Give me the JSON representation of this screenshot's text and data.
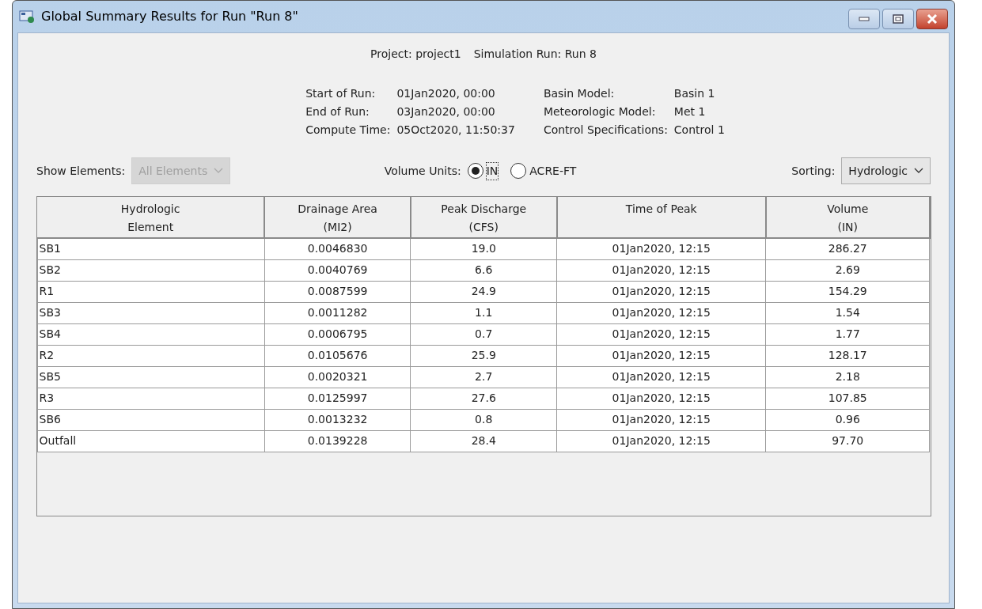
{
  "window": {
    "title": "Global Summary Results for Run \"Run 8\""
  },
  "header": {
    "project": "Project: project1",
    "simulation_run": "Simulation Run: Run 8"
  },
  "info_left": [
    {
      "label": "Start of Run:",
      "value": "01Jan2020, 00:00"
    },
    {
      "label": "End of Run:",
      "value": "03Jan2020, 00:00"
    },
    {
      "label": "Compute Time:",
      "value": "05Oct2020, 11:50:37"
    }
  ],
  "info_right": [
    {
      "label": "Basin Model:",
      "value": "Basin 1"
    },
    {
      "label": "Meteorologic Model:",
      "value": "Met 1"
    },
    {
      "label": "Control Specifications:",
      "value": "Control 1"
    }
  ],
  "show_elements": {
    "label": "Show Elements:",
    "value": "All Elements",
    "disabled": true
  },
  "volume_units": {
    "label": "Volume Units:",
    "options": [
      {
        "label": "IN",
        "selected": true
      },
      {
        "label": "ACRE-FT",
        "selected": false
      }
    ]
  },
  "sorting": {
    "label": "Sorting:",
    "value": "Hydrologic",
    "disabled": false
  },
  "table": {
    "columns": [
      "Hydrologic\nElement",
      "Drainage Area\n(MI2)",
      "Peak Discharge\n(CFS)",
      "Time of Peak",
      "Volume\n(IN)"
    ],
    "rows": [
      [
        "SB1",
        "0.0046830",
        "19.0",
        "01Jan2020, 12:15",
        "286.27"
      ],
      [
        "SB2",
        "0.0040769",
        "6.6",
        "01Jan2020, 12:15",
        "2.69"
      ],
      [
        "R1",
        "0.0087599",
        "24.9",
        "01Jan2020, 12:15",
        "154.29"
      ],
      [
        "SB3",
        "0.0011282",
        "1.1",
        "01Jan2020, 12:15",
        "1.54"
      ],
      [
        "SB4",
        "0.0006795",
        "0.7",
        "01Jan2020, 12:15",
        "1.77"
      ],
      [
        "R2",
        "0.0105676",
        "25.9",
        "01Jan2020, 12:15",
        "128.17"
      ],
      [
        "SB5",
        "0.0020321",
        "2.7",
        "01Jan2020, 12:15",
        "2.18"
      ],
      [
        "R3",
        "0.0125997",
        "27.6",
        "01Jan2020, 12:15",
        "107.85"
      ],
      [
        "SB6",
        "0.0013232",
        "0.8",
        "01Jan2020, 12:15",
        "0.96"
      ],
      [
        "Outfall",
        "0.0139228",
        "28.4",
        "01Jan2020, 12:15",
        "97.70"
      ]
    ]
  }
}
